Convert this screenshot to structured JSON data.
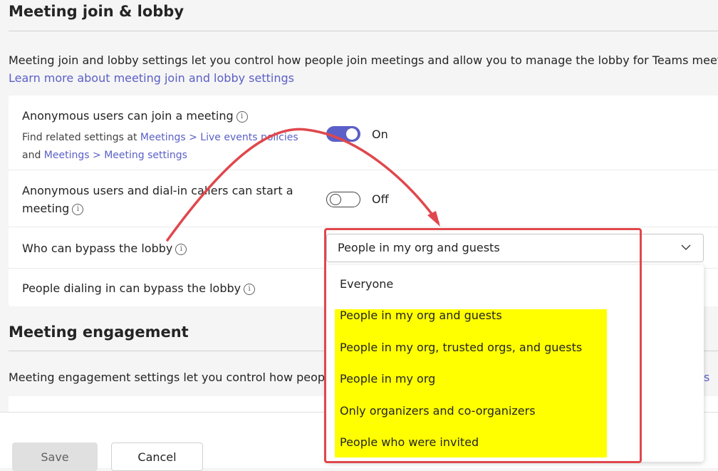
{
  "section1": {
    "title": "Meeting join & lobby",
    "description": "Meeting join and lobby settings let you control how people join meetings and allow you to manage the lobby for Teams meetings.",
    "learn_more": "Learn more about meeting join and lobby settings"
  },
  "settings": {
    "anon_join": {
      "label": "Anonymous users can join a meeting",
      "related_prefix": "Find related settings at",
      "link1_a": "Meetings",
      "sep": ">",
      "link1_b": "Live events policies",
      "and": "and",
      "link2_a": "Meetings",
      "link2_b": "Meeting settings",
      "state": "On"
    },
    "anon_start": {
      "label_line1": "Anonymous users and dial-in callers can start a",
      "label_line2": "meeting",
      "state": "Off"
    },
    "bypass": {
      "label": "Who can bypass the lobby",
      "selected": "People in my org and guests"
    },
    "dialin_bypass": {
      "label": "People dialing in can bypass the lobby"
    }
  },
  "dropdown": {
    "options": [
      "Everyone",
      "People in my org and guests",
      "People in my org, trusted orgs, and guests",
      "People in my org",
      "Only organizers and co-organizers",
      "People who were invited"
    ]
  },
  "section2": {
    "title": "Meeting engagement",
    "description": "Meeting engagement settings let you control how people",
    "trailing_link": "s"
  },
  "footer": {
    "save": "Save",
    "cancel": "Cancel"
  },
  "colors": {
    "accent": "#5b5fc7",
    "highlight": "#ffff00",
    "annotation": "#e0474c"
  }
}
